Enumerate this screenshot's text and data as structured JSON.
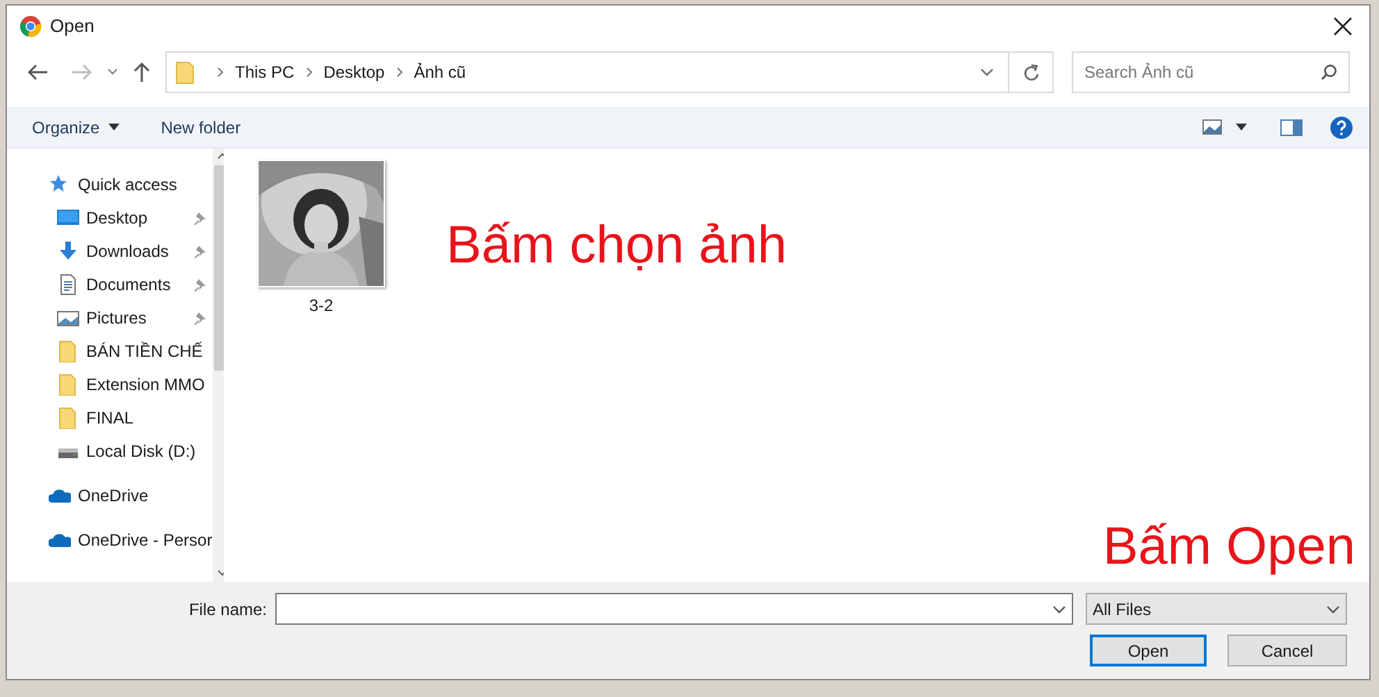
{
  "window": {
    "title": "Open"
  },
  "address": {
    "crumbs": [
      "This PC",
      "Desktop",
      "Ảnh cũ"
    ]
  },
  "search": {
    "placeholder": "Search Ảnh cũ"
  },
  "toolbar": {
    "organize": "Organize",
    "new_folder": "New folder"
  },
  "sidebar": {
    "items": [
      {
        "label": "Quick access",
        "kind": "star",
        "children": [
          {
            "label": "Desktop",
            "kind": "desktop",
            "pinned": true
          },
          {
            "label": "Downloads",
            "kind": "download",
            "pinned": true
          },
          {
            "label": "Documents",
            "kind": "document",
            "pinned": true
          },
          {
            "label": "Pictures",
            "kind": "pictures",
            "pinned": true
          },
          {
            "label": "BÁN TIỀN CHẾ",
            "kind": "folder",
            "pinned": false
          },
          {
            "label": "Extension MMO",
            "kind": "folder",
            "pinned": false
          },
          {
            "label": "FINAL",
            "kind": "folder",
            "pinned": false
          },
          {
            "label": "Local Disk (D:)",
            "kind": "drive",
            "pinned": false
          }
        ]
      },
      {
        "label": "OneDrive",
        "kind": "cloud"
      },
      {
        "label": "OneDrive - Persor",
        "kind": "cloud"
      }
    ]
  },
  "files": [
    {
      "name": "3-2",
      "kind": "picture"
    }
  ],
  "annotations": [
    "Bấm chọn ảnh",
    "Bấm Open"
  ],
  "bottom": {
    "file_name_label": "File name:",
    "file_type": "All Files",
    "open": "Open",
    "cancel": "Cancel"
  }
}
